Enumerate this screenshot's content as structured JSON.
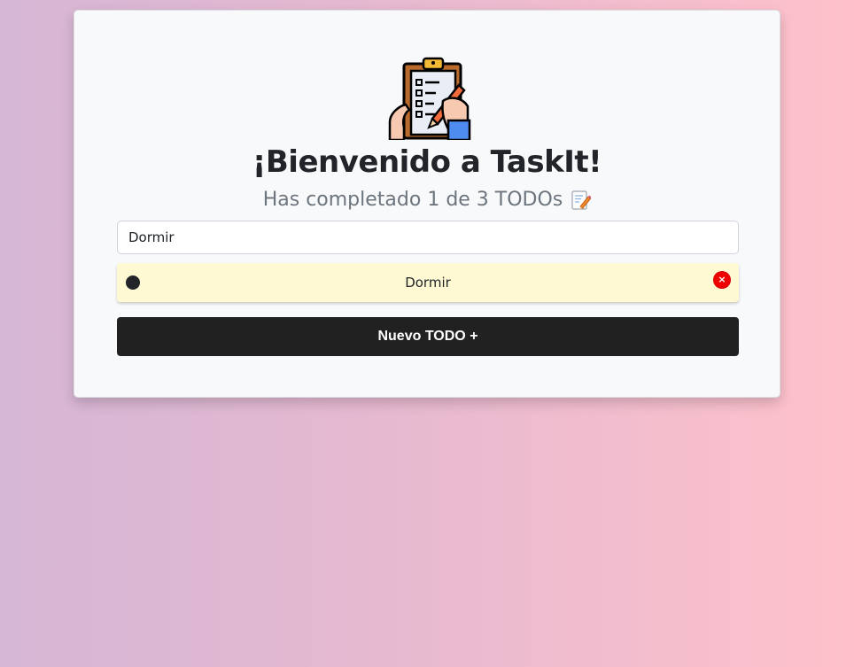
{
  "header": {
    "logo_icon": "clipboard-checklist-hand-icon",
    "title": "¡Bienvenido a TaskIt!",
    "subtitle": "Has completado 1 de 3 TODOs",
    "subtitle_icon": "memo-icon"
  },
  "search": {
    "value": "Dormir"
  },
  "todos": [
    {
      "text": "Dormir",
      "completed": false,
      "delete_icon": "close-icon",
      "delete_glyph": "×"
    }
  ],
  "actions": {
    "new_todo_label": "Nuevo TODO +"
  },
  "colors": {
    "todo_bg": "#fff9d3",
    "delete_red": "#f10000",
    "button_dark": "#212121"
  }
}
